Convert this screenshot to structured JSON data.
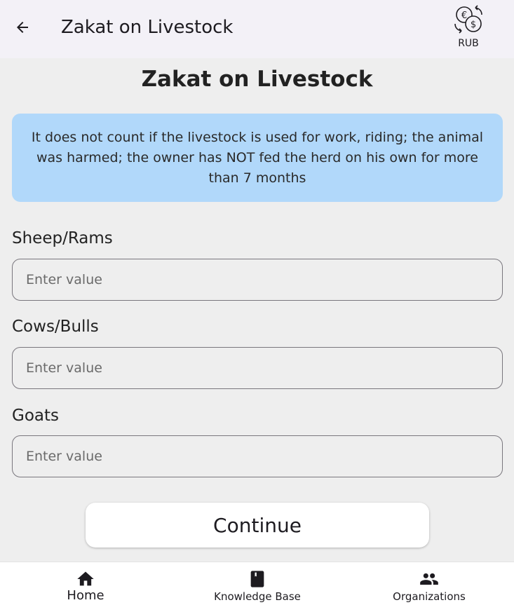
{
  "appbar": {
    "title": "Zakat on Livestock",
    "currency_label": "RUB"
  },
  "main": {
    "title": "Zakat on Livestock",
    "info_text": "It does not count if the livestock is used for work, riding; the animal was harmed; the owner has NOT fed the herd on his own for more than 7 months",
    "fields": [
      {
        "label": "Sheep/Rams",
        "placeholder": "Enter value",
        "value": ""
      },
      {
        "label": "Cows/Bulls",
        "placeholder": "Enter value",
        "value": ""
      },
      {
        "label": "Goats",
        "placeholder": "Enter value",
        "value": ""
      }
    ],
    "continue_label": "Continue"
  },
  "bottom_nav": {
    "items": [
      {
        "label": "Home",
        "icon": "home-icon",
        "active": true
      },
      {
        "label": "Knowledge Base",
        "icon": "book-icon",
        "active": false
      },
      {
        "label": "Organizations",
        "icon": "people-icon",
        "active": false
      }
    ]
  },
  "colors": {
    "appbar_bg": "#f3f1f7",
    "page_bg": "#eeeeee",
    "info_bg": "#b1d8fa",
    "nav_bg": "#ffffff"
  }
}
